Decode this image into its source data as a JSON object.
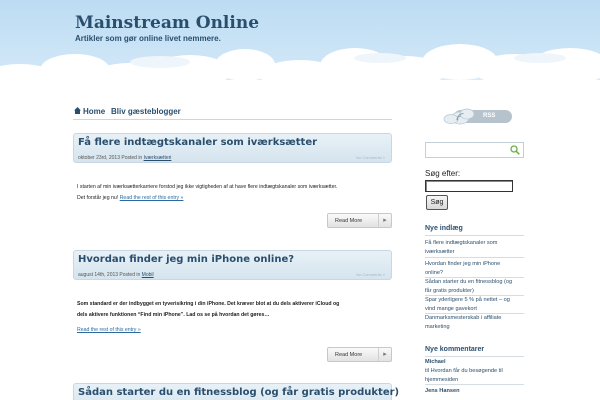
{
  "header": {
    "site_title": "Mainstream Online",
    "tagline": "Artikler som gør online livet nemmere."
  },
  "nav": {
    "items": [
      {
        "label": "Home"
      },
      {
        "label": "Bliv gæsteblogger"
      }
    ]
  },
  "posts": [
    {
      "title": "Få flere indtægtskanaler som iværksætter",
      "date_prefix": "oktober 23rd, 2013 Posted in",
      "category": "Iværksætteri",
      "comments": "No Comments »",
      "text_lines": [
        "I starten af min iværksætterkarriere forstod jeg ikke vigtigheden af at have flere indtægtskanaler som iværksætter.",
        "Det forstår jeg nu!"
      ],
      "read_rest": "Read the rest of this entry »",
      "read_more": "Read More"
    },
    {
      "title": "Hvordan finder jeg min iPhone online?",
      "date_prefix": "august 14th, 2013 Posted in",
      "category": "Mobil",
      "comments": "No Comments »",
      "text_lines": [
        "Som standard er der indbygget en tyverisikring i din iPhone. Det kræver blot at du dels aktiverer iCloud og",
        "dels aktivere funktionen “Find min iPhone”. Lad os se på hvordan det gøres…"
      ],
      "read_rest": "Read the rest of this entry »",
      "read_more": "Read More"
    },
    {
      "title": "Sådan starter du en fitnessblog (og får gratis produkter)"
    }
  ],
  "sidebar": {
    "rss_label": "RSS",
    "search_label": "Søg efter:",
    "search_value": "",
    "search_button": "Søg",
    "recent_posts_title": "Nye indlæg",
    "recent_posts": [
      [
        "Få flere indtægtskanaler som",
        "iværksætter"
      ],
      [
        "Hvordan finder jeg min iPhone",
        "online?"
      ],
      [
        "Sådan starter du en fitnessblog (og",
        "får gratis produkter)"
      ],
      [
        "Spar yderligere 5 % på nettet – og",
        "vind mange gavekort"
      ],
      [
        "Danmarksmesterskab i affiliate",
        "marketing"
      ]
    ],
    "recent_comments_title": "Nye kommentarer",
    "recent_comments": [
      {
        "name": "Michael",
        "lines": [
          "til Hvordan får du besøgende til",
          "hjemmesiden"
        ]
      },
      {
        "name": "Jens Hansen",
        "lines": []
      }
    ]
  },
  "colors": {
    "accent": "#2a4f6e",
    "sky": "#cfe6f7",
    "link": "#2a6aa0"
  }
}
